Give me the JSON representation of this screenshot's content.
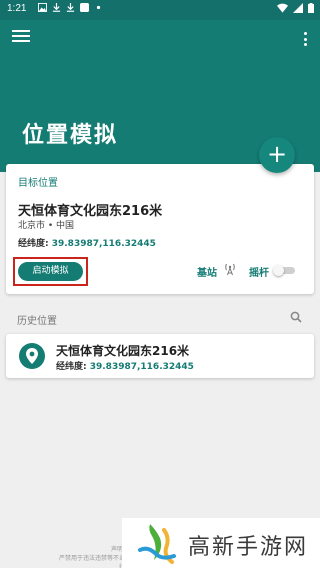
{
  "status_bar": {
    "time": "1:21"
  },
  "app_bar": {
    "title": "位置模拟",
    "fab_label": "+"
  },
  "target_card": {
    "header": "目标位置",
    "location_name": "天恒体育文化园东216米",
    "region": "北京市 • 中国",
    "coord_label": "经纬度: ",
    "coord_value": "39.83987,116.32445",
    "start_button": "启动模拟",
    "base_station_label": "基站",
    "joystick_label": "摇杆",
    "joystick_enabled": false
  },
  "history": {
    "header": "历史位置",
    "items": [
      {
        "name": "天恒体育文化园东216米",
        "coord_label": "经纬度: ",
        "coord_value": "39.83987,116.32445"
      }
    ]
  },
  "footer": {
    "disclaimer_line1": "声明:",
    "disclaimer_line2": "严禁用于违法违禁等不当行"
  },
  "watermark": {
    "text": "高新手游网"
  },
  "colors": {
    "primary": "#157c74",
    "highlight_border": "#c9251c",
    "background": "#efefef"
  }
}
